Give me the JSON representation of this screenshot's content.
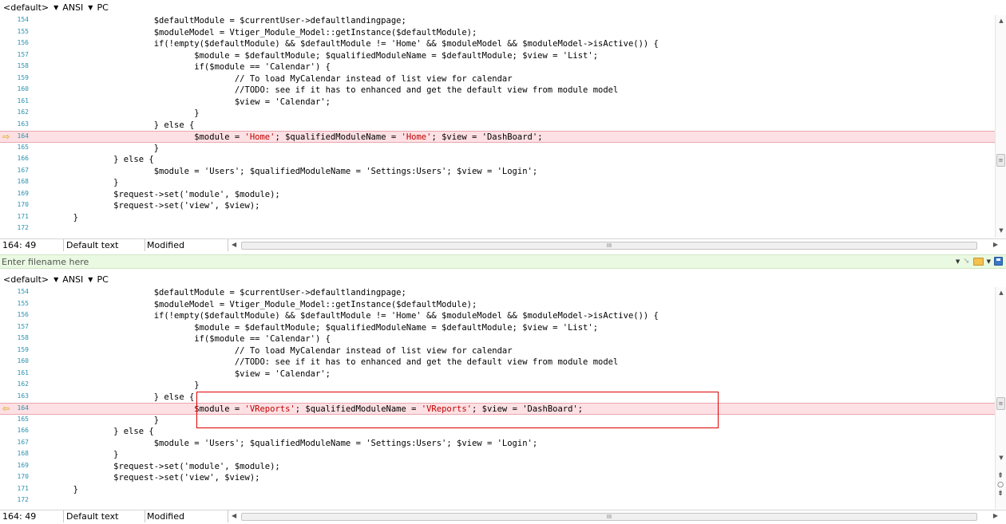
{
  "top_pane": {
    "encoding_bar": {
      "profile": "<default>",
      "encoding": "ANSI",
      "line_ending": "PC"
    },
    "lines": [
      {
        "num": "154",
        "segs": [
          {
            "t": "                        $defaultModule = $currentUser->defaultlandingpage;"
          }
        ]
      },
      {
        "num": "155",
        "segs": [
          {
            "t": "                        $moduleModel = Vtiger_Module_Model::getInstance($defaultModule);"
          }
        ]
      },
      {
        "num": "156",
        "segs": [
          {
            "t": "                        if(!empty($defaultModule) && $defaultModule != 'Home' && $moduleModel && $moduleModel->isActive()) {"
          }
        ]
      },
      {
        "num": "157",
        "segs": [
          {
            "t": "                                $module = $defaultModule; $qualifiedModuleName = $defaultModule; $view = 'List';"
          }
        ]
      },
      {
        "num": "158",
        "segs": [
          {
            "t": "                                if($module == 'Calendar') {"
          }
        ]
      },
      {
        "num": "159",
        "segs": [
          {
            "t": "                                        // To load MyCalendar instead of list view for calendar"
          }
        ]
      },
      {
        "num": "160",
        "segs": [
          {
            "t": "                                        //TODO: see if it has to enhanced and get the default view from module model"
          }
        ]
      },
      {
        "num": "161",
        "segs": [
          {
            "t": "                                        $view = 'Calendar';"
          }
        ]
      },
      {
        "num": "162",
        "segs": [
          {
            "t": "                                }"
          }
        ]
      },
      {
        "num": "163",
        "segs": [
          {
            "t": "                        } else {"
          }
        ]
      },
      {
        "num": "164",
        "diff": true,
        "segs": [
          {
            "t": "                                $module = "
          },
          {
            "t": "'Home'",
            "s": true
          },
          {
            "t": "; $qualifiedModuleName = "
          },
          {
            "t": "'Home'",
            "s": true
          },
          {
            "t": "; $view = 'DashBoard';"
          }
        ]
      },
      {
        "num": "165",
        "segs": [
          {
            "t": "                        }"
          }
        ]
      },
      {
        "num": "166",
        "segs": [
          {
            "t": "                } else {"
          }
        ]
      },
      {
        "num": "167",
        "segs": [
          {
            "t": "                        $module = 'Users'; $qualifiedModuleName = 'Settings:Users'; $view = 'Login';"
          }
        ]
      },
      {
        "num": "168",
        "segs": [
          {
            "t": "                }"
          }
        ]
      },
      {
        "num": "169",
        "segs": [
          {
            "t": "                $request->set('module', $module);"
          }
        ]
      },
      {
        "num": "170",
        "segs": [
          {
            "t": "                $request->set('view', $view);"
          }
        ]
      },
      {
        "num": "171",
        "segs": [
          {
            "t": "        }"
          }
        ]
      },
      {
        "num": "172",
        "segs": [
          {
            "t": ""
          }
        ]
      }
    ],
    "status": {
      "position": "164: 49",
      "mode": "Default text",
      "state": "Modified"
    }
  },
  "filename_bar": {
    "placeholder": "Enter filename here"
  },
  "bottom_pane": {
    "encoding_bar": {
      "profile": "<default>",
      "encoding": "ANSI",
      "line_ending": "PC"
    },
    "lines": [
      {
        "num": "154",
        "segs": [
          {
            "t": "                        $defaultModule = $currentUser->defaultlandingpage;"
          }
        ]
      },
      {
        "num": "155",
        "segs": [
          {
            "t": "                        $moduleModel = Vtiger_Module_Model::getInstance($defaultModule);"
          }
        ]
      },
      {
        "num": "156",
        "segs": [
          {
            "t": "                        if(!empty($defaultModule) && $defaultModule != 'Home' && $moduleModel && $moduleModel->isActive()) {"
          }
        ]
      },
      {
        "num": "157",
        "segs": [
          {
            "t": "                                $module = $defaultModule; $qualifiedModuleName = $defaultModule; $view = 'List';"
          }
        ]
      },
      {
        "num": "158",
        "segs": [
          {
            "t": "                                if($module == 'Calendar') {"
          }
        ]
      },
      {
        "num": "159",
        "segs": [
          {
            "t": "                                        // To load MyCalendar instead of list view for calendar"
          }
        ]
      },
      {
        "num": "160",
        "segs": [
          {
            "t": "                                        //TODO: see if it has to enhanced and get the default view from module model"
          }
        ]
      },
      {
        "num": "161",
        "segs": [
          {
            "t": "                                        $view = 'Calendar';"
          }
        ]
      },
      {
        "num": "162",
        "segs": [
          {
            "t": "                                }"
          }
        ]
      },
      {
        "num": "163",
        "segs": [
          {
            "t": "                        } else {"
          }
        ]
      },
      {
        "num": "164",
        "diff": true,
        "segs": [
          {
            "t": "                                $module = "
          },
          {
            "t": "'VReports'",
            "s": true
          },
          {
            "t": "; $qualifiedModuleName = "
          },
          {
            "t": "'VReports'",
            "s": true
          },
          {
            "t": "; $view = 'DashBoard';"
          }
        ]
      },
      {
        "num": "165",
        "segs": [
          {
            "t": "                        }"
          }
        ]
      },
      {
        "num": "166",
        "segs": [
          {
            "t": "                } else {"
          }
        ]
      },
      {
        "num": "167",
        "segs": [
          {
            "t": "                        $module = 'Users'; $qualifiedModuleName = 'Settings:Users'; $view = 'Login';"
          }
        ]
      },
      {
        "num": "168",
        "segs": [
          {
            "t": "                }"
          }
        ]
      },
      {
        "num": "169",
        "segs": [
          {
            "t": "                $request->set('module', $module);"
          }
        ]
      },
      {
        "num": "170",
        "segs": [
          {
            "t": "                $request->set('view', $view);"
          }
        ]
      },
      {
        "num": "171",
        "segs": [
          {
            "t": "        }"
          }
        ]
      },
      {
        "num": "172",
        "segs": [
          {
            "t": ""
          }
        ]
      }
    ],
    "status": {
      "position": "164: 49",
      "mode": "Default text",
      "state": "Modified"
    }
  },
  "colors": {
    "diff_background": "#fde0e3",
    "string_changed": "#c00000",
    "line_number": "#2b91af",
    "filename_bar": "#eaf9e2",
    "highlight_box": "#e00000"
  },
  "icons": {
    "diff_marker_top": "arrow-right-icon",
    "diff_marker_bottom": "arrow-left-icon"
  }
}
